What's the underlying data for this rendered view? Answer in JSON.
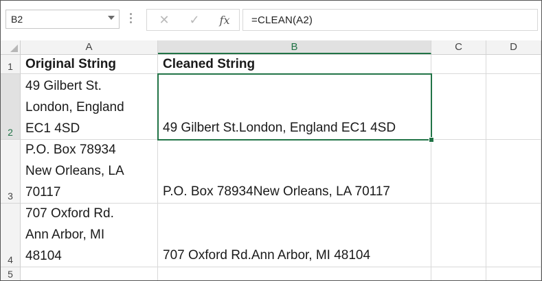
{
  "name_box": {
    "value": "B2"
  },
  "formula_bar": {
    "cancel_icon": "✕",
    "enter_icon": "✓",
    "fx_icon": "fx",
    "formula": "=CLEAN(A2)"
  },
  "columns": [
    "A",
    "B",
    "C",
    "D"
  ],
  "rows": [
    {
      "number": "1",
      "a": "Original String",
      "b": "Cleaned String"
    },
    {
      "number": "2",
      "a": "49 Gilbert St.\nLondon, England\nEC1 4SD",
      "b": "49 Gilbert St.London, England EC1 4SD"
    },
    {
      "number": "3",
      "a": "P.O. Box 78934\nNew Orleans, LA\n70117",
      "b": "P.O. Box 78934New Orleans, LA 70117"
    },
    {
      "number": "4",
      "a": "707 Oxford Rd.\nAnn Arbor, MI\n48104",
      "b": "707 Oxford Rd.Ann Arbor, MI 48104"
    },
    {
      "number": "5",
      "a": "",
      "b": ""
    }
  ],
  "selected_cell": "B2",
  "accent_color": "#217346"
}
